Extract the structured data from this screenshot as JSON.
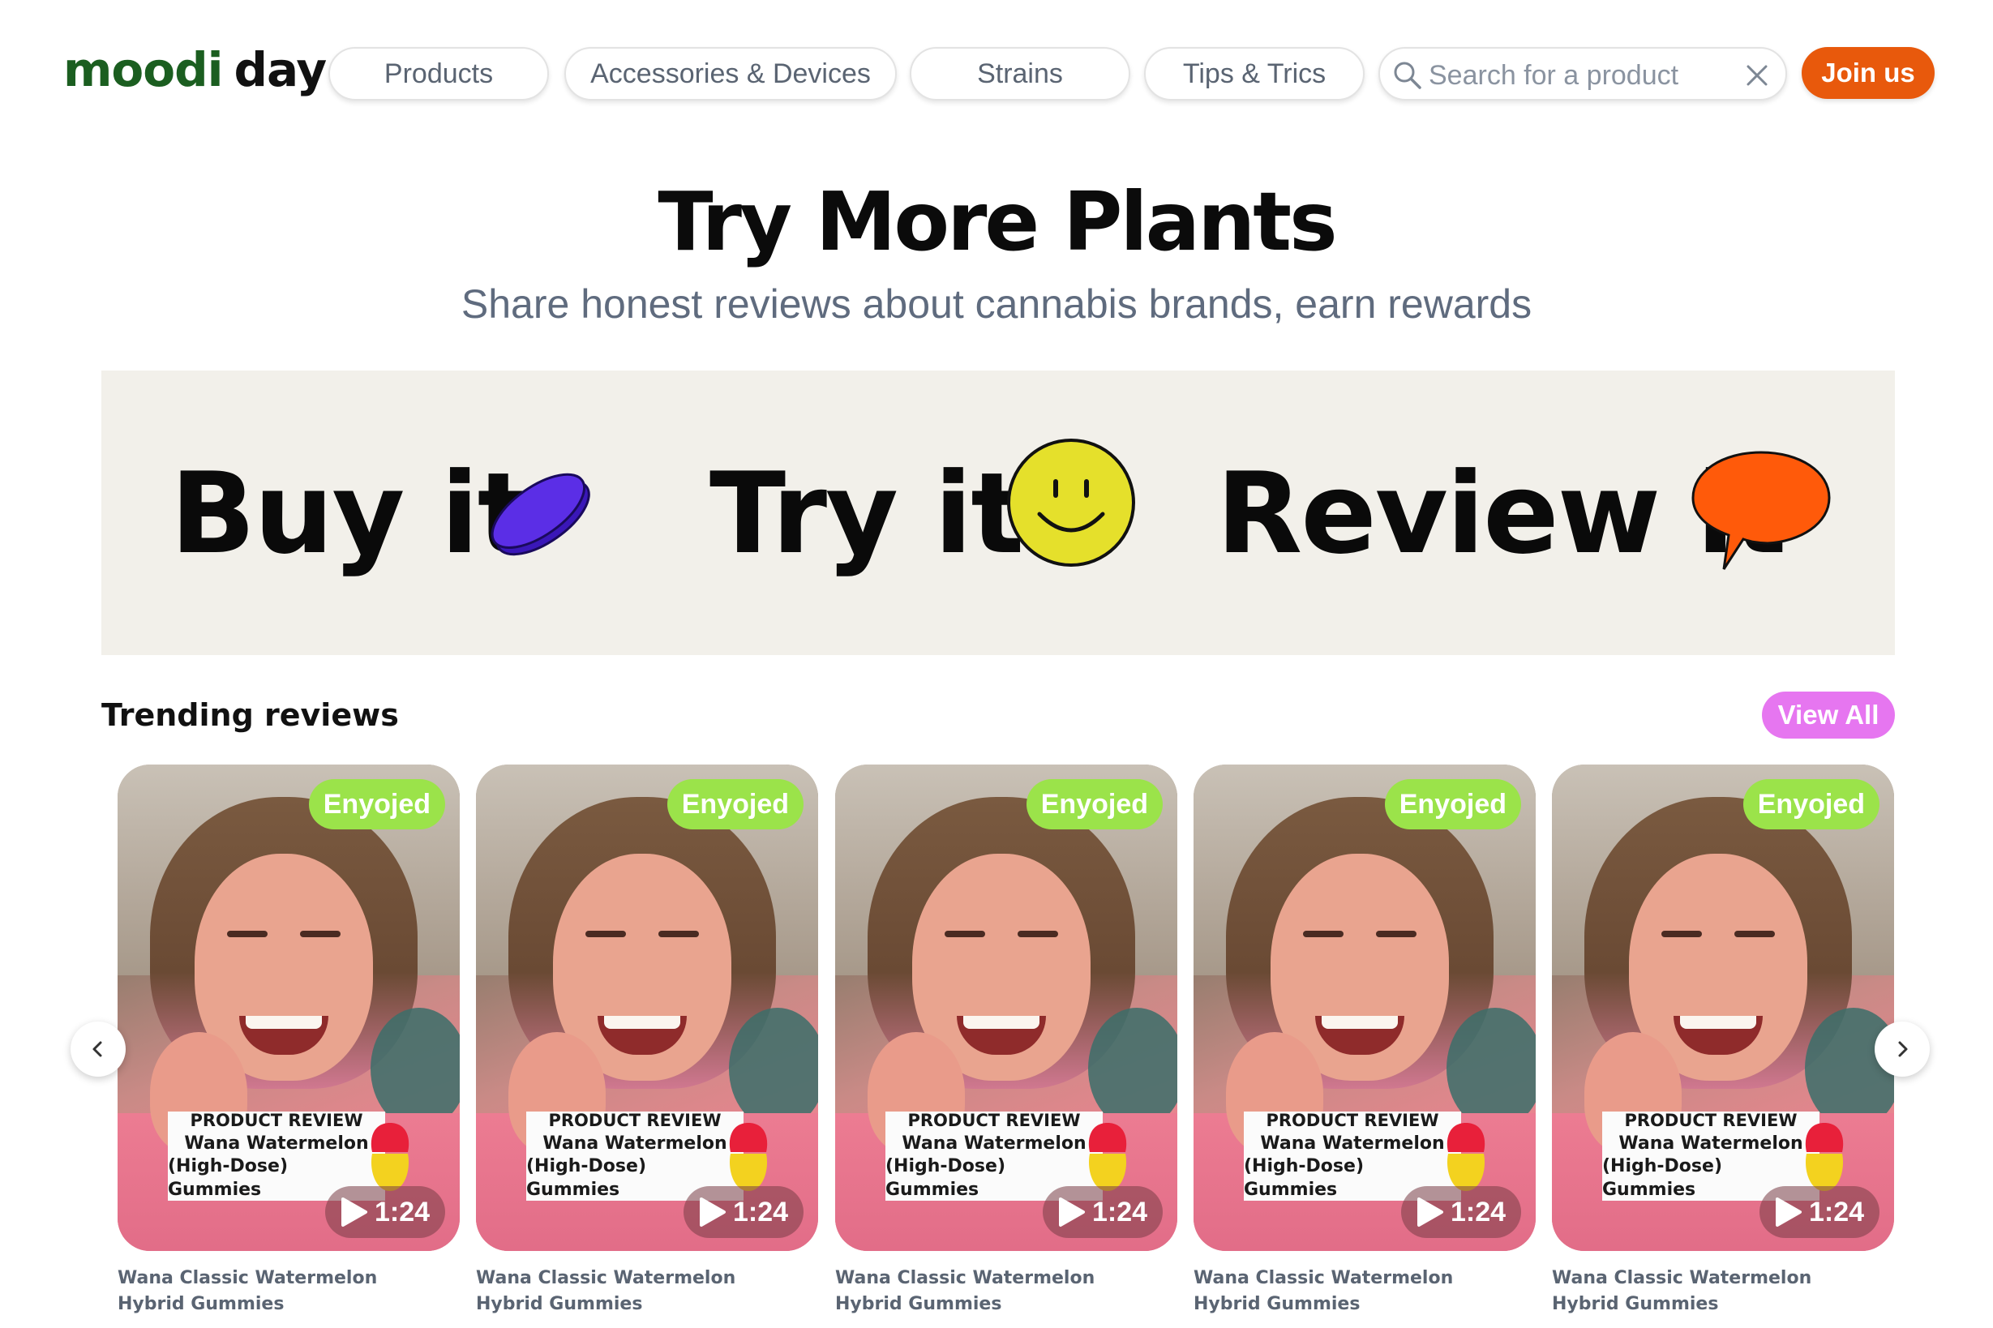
{
  "brand": {
    "word1": "moodi",
    "word2": "day"
  },
  "nav": {
    "items": [
      {
        "label": "Products"
      },
      {
        "label": "Accessories & Devices"
      },
      {
        "label": "Strains"
      },
      {
        "label": "Tips & Trics"
      }
    ],
    "search_placeholder": "Search for a product",
    "join_label": "Join us"
  },
  "hero": {
    "title": "Try More Plants",
    "subtitle": "Share honest reviews about cannabis brands, earn rewards"
  },
  "banner": {
    "steps": [
      {
        "label": "Buy it",
        "icon": "coin-icon"
      },
      {
        "label": "Try it",
        "icon": "smiley-icon"
      },
      {
        "label": "Review it",
        "icon": "speech-bubble-icon"
      }
    ]
  },
  "trending": {
    "title": "Trending reviews",
    "view_all_label": "View All",
    "cards": [
      {
        "badge": "Enyojed",
        "overlay_line1": "PRODUCT REVIEW",
        "overlay_line2": "Wana Watermelon",
        "overlay_line3": "(High-Dose) Gummies",
        "duration": "1:24",
        "title": "Wana Classic Watermelon Hybrid Gummies"
      },
      {
        "badge": "Enyojed",
        "overlay_line1": "PRODUCT REVIEW",
        "overlay_line2": "Wana Watermelon",
        "overlay_line3": "(High-Dose) Gummies",
        "duration": "1:24",
        "title": "Wana Classic Watermelon Hybrid Gummies"
      },
      {
        "badge": "Enyojed",
        "overlay_line1": "PRODUCT REVIEW",
        "overlay_line2": "Wana Watermelon",
        "overlay_line3": "(High-Dose) Gummies",
        "duration": "1:24",
        "title": "Wana Classic Watermelon Hybrid Gummies"
      },
      {
        "badge": "Enyojed",
        "overlay_line1": "PRODUCT REVIEW",
        "overlay_line2": "Wana Watermelon",
        "overlay_line3": "(High-Dose) Gummies",
        "duration": "1:24",
        "title": "Wana Classic Watermelon Hybrid Gummies"
      },
      {
        "badge": "Enyojed",
        "overlay_line1": "PRODUCT REVIEW",
        "overlay_line2": "Wana Watermelon",
        "overlay_line3": "(High-Dose) Gummies",
        "duration": "1:24",
        "title": "Wana Classic Watermelon Hybrid Gummies"
      }
    ]
  },
  "colors": {
    "brand_green": "#1b5e20",
    "join_orange": "#e8590c",
    "view_all_pink": "#e676f0",
    "badge_green": "#9be34a",
    "banner_bg": "#f2f0ea",
    "coin_purple": "#5b2ee6",
    "smiley_yellow": "#e5e02b",
    "bubble_orange": "#ff5a0a"
  }
}
